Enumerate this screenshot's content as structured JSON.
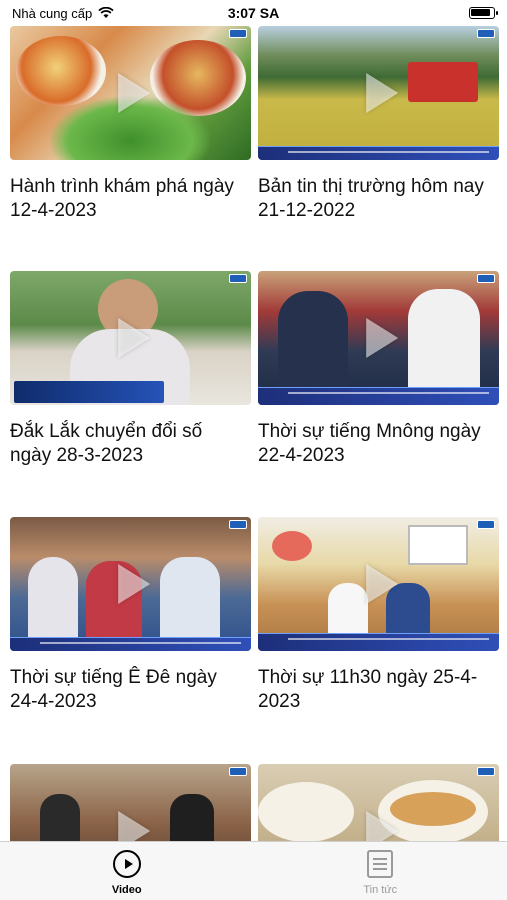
{
  "status": {
    "carrier": "Nhà cung cấp",
    "time": "3:07 SA"
  },
  "videos": [
    {
      "title": "Hành trình khám phá ngày 12-4-2023"
    },
    {
      "title": "Bản tin thị trường hôm nay 21-12-2022"
    },
    {
      "title": "Đắk Lắk chuyển đổi số ngày 28-3-2023"
    },
    {
      "title": "Thời sự tiếng Mnông ngày 22-4-2023"
    },
    {
      "title": "Thời sự tiếng Ê Đê ngày 24-4-2023"
    },
    {
      "title": "Thời sự 11h30 ngày 25-4-2023"
    },
    {
      "title": ""
    },
    {
      "title": ""
    }
  ],
  "tabs": [
    {
      "label": "Video",
      "icon": "play-circle-icon",
      "active": true
    },
    {
      "label": "Tin tức",
      "icon": "newspaper-icon",
      "active": false
    }
  ],
  "colors": {
    "accent": "#000000",
    "inactive": "#9a9a9a",
    "tabbar_bg": "#f7f7f7",
    "broadcast_blue": "#1f5fb8"
  }
}
